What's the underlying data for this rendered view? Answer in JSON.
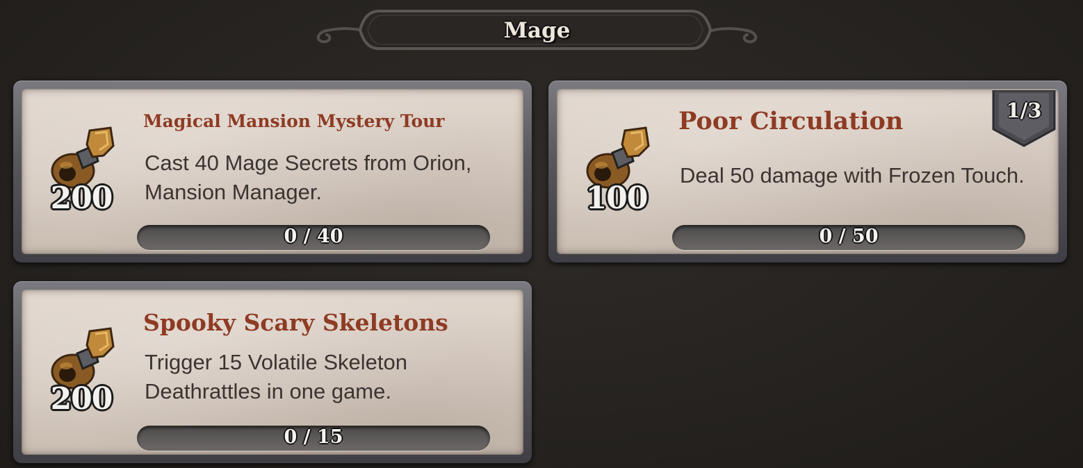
{
  "header": {
    "title": "Mage"
  },
  "quests": [
    {
      "title": "Magical Mansion Mystery Tour",
      "description": "Cast 40 Mage Secrets from Orion, Mansion Manager.",
      "reward_icon": "gold-pouch-icon",
      "reward_amount": "200",
      "progress_text": "0 / 40",
      "progress_current": 0,
      "progress_total": 40
    },
    {
      "title": "Poor Circulation",
      "description": "Deal 50 damage with Frozen Touch.",
      "reward_icon": "gold-pouch-icon",
      "reward_amount": "100",
      "progress_text": "0 / 50",
      "progress_current": 0,
      "progress_total": 50,
      "step_badge": "1/3"
    },
    {
      "title": "Spooky Scary Skeletons",
      "description": "Trigger 15 Volatile Skeleton Deathrattles in one game.",
      "reward_icon": "gold-pouch-icon",
      "reward_amount": "200",
      "progress_text": "0 / 15",
      "progress_current": 0,
      "progress_total": 15
    }
  ],
  "colors": {
    "background": "#262320",
    "title_red": "#8e3b23",
    "parchment": "#d6cbc1",
    "frame": "#56565c",
    "text_dark": "#3b3431"
  }
}
